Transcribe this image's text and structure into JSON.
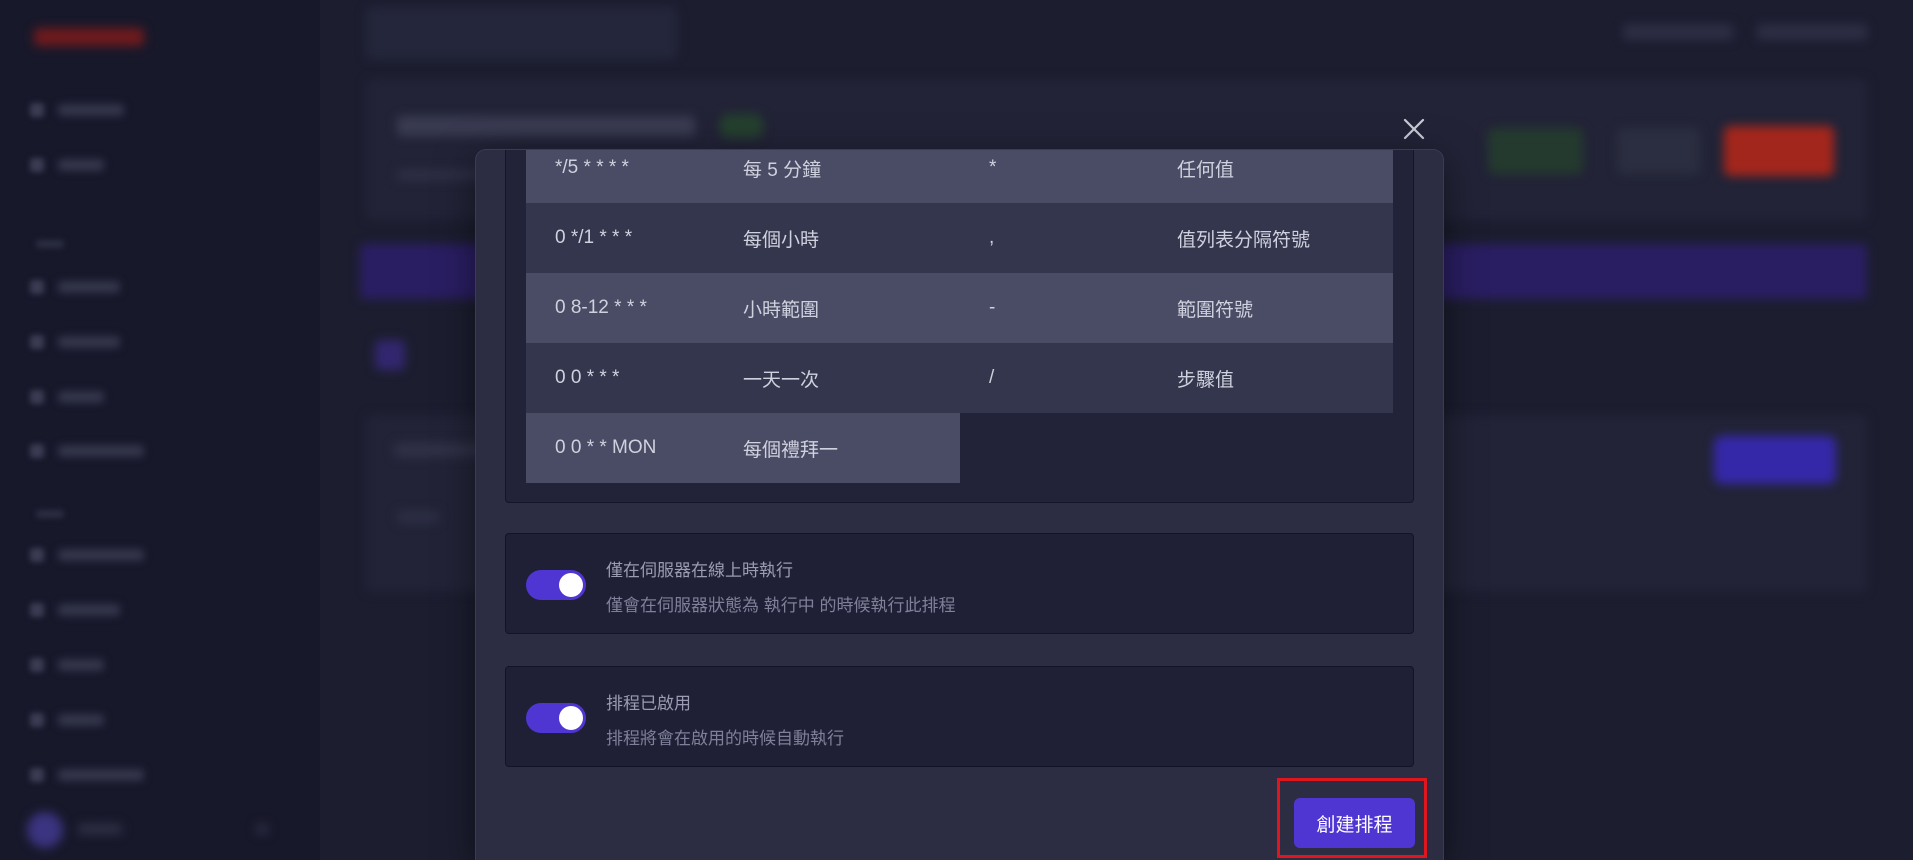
{
  "colors": {
    "accent": "#4f36d2",
    "highlight": "#e0161e"
  },
  "modal": {
    "close_icon": "close-icon",
    "cron_examples": {
      "rows": [
        {
          "expression": "*/5 * * * *",
          "expression_desc": "每 5 分鐘",
          "symbol": "*",
          "symbol_desc": "任何值"
        },
        {
          "expression": "0 */1 * * *",
          "expression_desc": "每個小時",
          "symbol": ",",
          "symbol_desc": "值列表分隔符號"
        },
        {
          "expression": "0 8-12 * * *",
          "expression_desc": "小時範圍",
          "symbol": "-",
          "symbol_desc": "範圍符號"
        },
        {
          "expression": "0 0 * * *",
          "expression_desc": "一天一次",
          "symbol": "/",
          "symbol_desc": "步驟值"
        },
        {
          "expression": "0 0 * * MON",
          "expression_desc": "每個禮拜一"
        }
      ]
    },
    "options": [
      {
        "label": "僅在伺服器在線上時執行",
        "description": "僅會在伺服器狀態為 執行中 的時候執行此排程",
        "enabled": true
      },
      {
        "label": "排程已啟用",
        "description": "排程將會在啟用的時候自動執行",
        "enabled": true
      }
    ],
    "create_button_label": "創建排程"
  }
}
